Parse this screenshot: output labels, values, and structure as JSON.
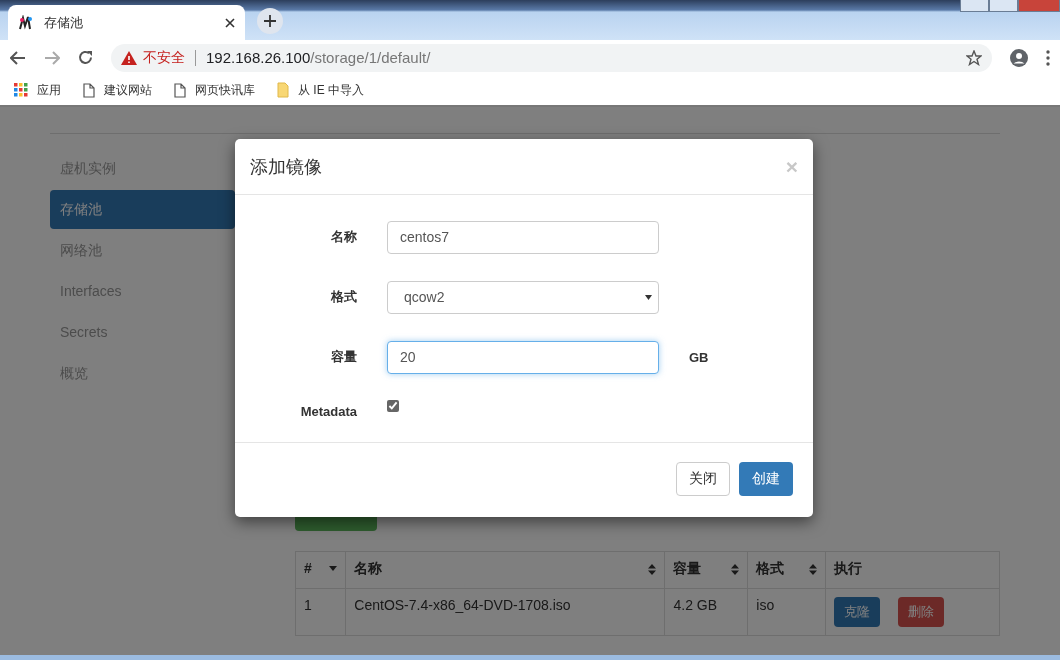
{
  "browser": {
    "tab_title": "存储池",
    "address": {
      "warning": "不安全",
      "host": "192.168.26.100",
      "path": "/storage/1/default/"
    },
    "bookmarks": [
      {
        "kind": "apps",
        "label": "应用"
      },
      {
        "kind": "page",
        "label": "建议网站"
      },
      {
        "kind": "page",
        "label": "网页快讯库"
      },
      {
        "kind": "folder",
        "label": "从 IE 中导入"
      }
    ]
  },
  "sidebar": {
    "items": [
      {
        "label": "虚机实例",
        "selected": false
      },
      {
        "label": "存储池",
        "selected": true
      },
      {
        "label": "网络池",
        "selected": false
      },
      {
        "label": "Interfaces",
        "selected": false
      },
      {
        "label": "Secrets",
        "selected": false
      },
      {
        "label": "概览",
        "selected": false
      }
    ]
  },
  "table": {
    "columns": [
      {
        "label": "#",
        "kind": "sorted"
      },
      {
        "label": "名称",
        "kind": "sortable"
      },
      {
        "label": "容量",
        "kind": "sortable"
      },
      {
        "label": "格式",
        "kind": "sortable"
      },
      {
        "label": "执行",
        "kind": "plain"
      }
    ],
    "rows": [
      {
        "cells": [
          "1",
          "CentOS-7.4-x86_64-DVD-1708.iso",
          "4.2 GB",
          "iso"
        ],
        "actions": [
          {
            "kind": "primary",
            "label": "克隆"
          },
          {
            "kind": "danger",
            "label": "删除"
          }
        ]
      }
    ]
  },
  "modal": {
    "title": "添加镜像",
    "close": "×",
    "fields": [
      {
        "kind": "text",
        "label": "名称",
        "value": "centos7",
        "focused": false
      },
      {
        "kind": "select",
        "label": "格式",
        "value": "qcow2"
      },
      {
        "kind": "text",
        "label": "容量",
        "value": "20",
        "focused": true,
        "unit": "GB"
      },
      {
        "kind": "checkbox",
        "label": "Metadata",
        "checked": true
      }
    ],
    "buttons": [
      {
        "kind": "default",
        "label": "关闭"
      },
      {
        "kind": "primary",
        "label": "创建"
      }
    ]
  }
}
